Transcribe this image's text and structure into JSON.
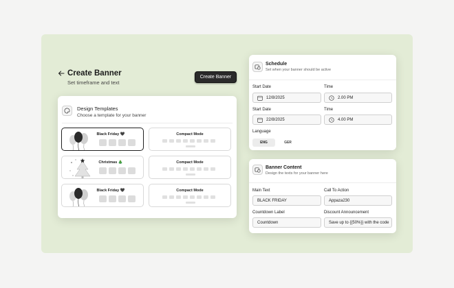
{
  "header": {
    "title": "Create Banner",
    "subtitle": "Set timeframe and text",
    "create_button": "Create Banner"
  },
  "templates": {
    "title": "Design Templates",
    "subtitle": "Choose a template for your banner",
    "items": [
      {
        "label": "Black Friday 🖤",
        "art": "balloons-art",
        "selected": true
      },
      {
        "label": "Compact Mode",
        "art": "none",
        "selected": false
      },
      {
        "label": "Christmas 🎄",
        "art": "tree-art",
        "selected": false
      },
      {
        "label": "Compact Mode",
        "art": "none",
        "selected": false
      },
      {
        "label": "Black Friday 🖤",
        "art": "balloons-art",
        "selected": false
      },
      {
        "label": "Compact Mode",
        "art": "none",
        "selected": false
      }
    ]
  },
  "schedule": {
    "title": "Schedule",
    "subtitle": "Set when your banner should be active",
    "start_date_label_1": "Start Date",
    "start_date_1": "12/8/2025",
    "time_label_1": "Time",
    "time_1": "2.00 PM",
    "start_date_label_2": "Start Date",
    "start_date_2": "22/8/2025",
    "time_label_2": "Time",
    "time_2": "4.00 PM",
    "language_label": "Language",
    "languages": [
      "ENG",
      "GER"
    ],
    "active_language": "ENG"
  },
  "banner_content": {
    "title": "Banner Content",
    "subtitle": "Design the texts for your banner here",
    "main_text_label": "Main Text",
    "main_text": "BLACK FRIDAY",
    "cta_label": "Call To Action",
    "cta": "Appaza230",
    "countdown_label": "Countdown Label",
    "countdown": "Countdown",
    "discount_label": "Discount Announcement",
    "discount": "Save up to {{50%}} with the code"
  },
  "colors": {
    "stage": "#e3ecd6",
    "button": "#2a2a2a",
    "card": "#ffffff"
  }
}
